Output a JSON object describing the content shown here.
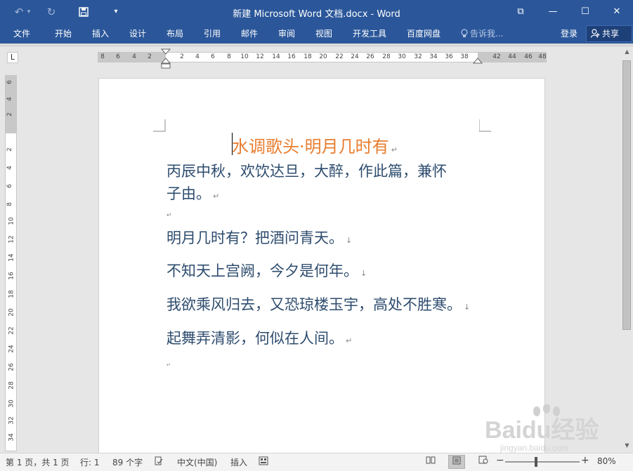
{
  "window": {
    "title": "新建 Microsoft Word 文档.docx - Word",
    "controls": {
      "ribbon_options": "⧉",
      "minimize": "—",
      "maximize": "☐",
      "close": "✕"
    }
  },
  "quick_access": {
    "undo": "↶",
    "undo_dropdown": "▾",
    "redo": "↻",
    "save_icon": "save-icon",
    "customize": "▾"
  },
  "ribbon": {
    "tabs": [
      "文件",
      "开始",
      "插入",
      "设计",
      "布局",
      "引用",
      "邮件",
      "审阅",
      "视图",
      "开发工具",
      "百度网盘"
    ],
    "tell_me": "告诉我...",
    "login": "登录",
    "share": "共享"
  },
  "rulers": {
    "corner": "L",
    "horizontal_ticks": [
      "8",
      "6",
      "4",
      "2",
      "2",
      "4",
      "6",
      "8",
      "10",
      "12",
      "14",
      "16",
      "18",
      "20",
      "22",
      "24",
      "26",
      "28",
      "30",
      "32",
      "34",
      "36",
      "38",
      "42",
      "44",
      "46",
      "48"
    ],
    "vertical_ticks": [
      "6",
      "4",
      "2",
      "2",
      "4",
      "6",
      "8",
      "10",
      "12",
      "14",
      "16",
      "18",
      "20",
      "22",
      "24",
      "26",
      "28",
      "30",
      "32",
      "34"
    ]
  },
  "document": {
    "title": "水调歌头·明月几时有",
    "paragraphs": [
      "丙辰中秋，欢饮达旦，大醉，作此篇，兼怀",
      "子由。",
      "明月几时有？把酒问青天。",
      "不知天上宫阙，今夕是何年。",
      "我欲乘风归去，又恐琼楼玉宇，高处不胜寒。",
      "起舞弄清影，何似在人间。"
    ],
    "paragraph_mark": "↵",
    "line_break_mark": "↓",
    "empty_mark": "↵",
    "colors": {
      "title": "#e87d2e",
      "body": "#2e4c6e"
    }
  },
  "status": {
    "page": "第 1 页，共 1 页",
    "line": "行: 1",
    "words": "89 个字",
    "language": "中文(中国)",
    "mode": "插入",
    "zoom": "80%",
    "zoom_minus": "−",
    "zoom_plus": "+"
  },
  "watermark": {
    "brand": "Baidu经验",
    "url": "jingyan.baidu.com"
  },
  "colors": {
    "accent": "#2b579a"
  }
}
